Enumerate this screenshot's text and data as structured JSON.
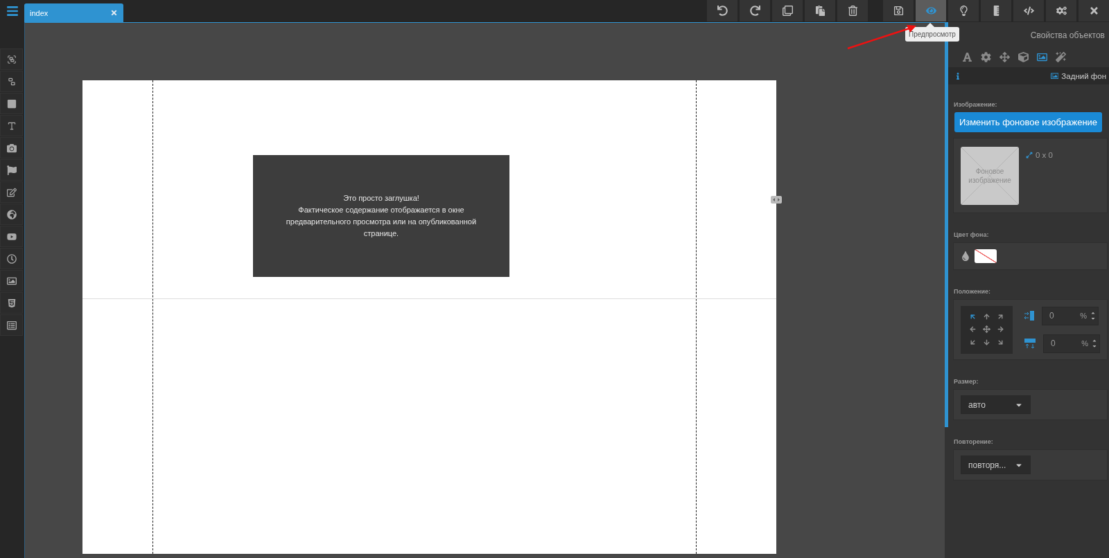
{
  "menu_button": {
    "kind": "menu"
  },
  "tabs": [
    {
      "label": "index",
      "selected": true
    }
  ],
  "toolbar": [
    {
      "kind": "undo",
      "selected": false
    },
    {
      "kind": "redo",
      "selected": false
    },
    {
      "kind": "copy",
      "selected": false
    },
    {
      "kind": "paste",
      "selected": false
    },
    {
      "kind": "delete",
      "selected": false
    },
    {
      "kind": "gap"
    },
    {
      "kind": "save",
      "selected": false
    },
    {
      "kind": "preview",
      "selected": true
    },
    {
      "kind": "idea",
      "selected": false
    },
    {
      "kind": "ruler",
      "selected": false
    },
    {
      "kind": "code",
      "selected": false
    },
    {
      "kind": "settings",
      "selected": false
    },
    {
      "kind": "close",
      "selected": false
    }
  ],
  "tooltip": {
    "text": "Предпросмотр"
  },
  "annotation": {
    "kind": "arrow",
    "color": "#ee1111"
  },
  "tools": [
    {
      "kind": "group"
    },
    {
      "kind": "ungroup"
    },
    {
      "kind": "box"
    },
    {
      "kind": "text"
    },
    {
      "kind": "camera"
    },
    {
      "kind": "flag"
    },
    {
      "kind": "edit"
    },
    {
      "kind": "globe"
    },
    {
      "kind": "video"
    },
    {
      "kind": "clock"
    },
    {
      "kind": "image"
    },
    {
      "kind": "html"
    },
    {
      "kind": "form"
    }
  ],
  "canvas": {
    "placeholder": {
      "lines": [
        "Это просто заглушка!",
        "Фактическое содержание отображается в окне",
        "предварительного просмотра или на опубликованной",
        "странице."
      ]
    }
  },
  "panel": {
    "title": "Свойства объектов",
    "tabs": [
      {
        "kind": "font",
        "selected": false
      },
      {
        "kind": "settings",
        "selected": false
      },
      {
        "kind": "move",
        "selected": false
      },
      {
        "kind": "cube",
        "selected": false
      },
      {
        "kind": "image",
        "selected": true
      },
      {
        "kind": "magic",
        "selected": false
      }
    ],
    "section_title": "Задний фон",
    "image": {
      "label": "Изображение:",
      "button": "Изменить фоновое изображение",
      "thumbnail": "Фоновое изображение",
      "size": "0 x 0"
    },
    "color": {
      "label": "Цвет фона:",
      "transparent": true
    },
    "position": {
      "label": "Положение:",
      "anchors": [
        {
          "kind": "up-left",
          "selected": true
        },
        {
          "kind": "up",
          "selected": false
        },
        {
          "kind": "up-right",
          "selected": false
        },
        {
          "kind": "left",
          "selected": false
        },
        {
          "kind": "center",
          "selected": false
        },
        {
          "kind": "right",
          "selected": false
        },
        {
          "kind": "down-left",
          "selected": false
        },
        {
          "kind": "down",
          "selected": false
        },
        {
          "kind": "down-right",
          "selected": false
        }
      ],
      "fields": [
        {
          "kind": "horizontal",
          "value": "0",
          "unit": "%"
        },
        {
          "kind": "vertical",
          "value": "0",
          "unit": "%"
        }
      ]
    },
    "size": {
      "label": "Размер:",
      "value": "авто"
    },
    "repeat": {
      "label": "Повторение:",
      "value": "повторя..."
    }
  }
}
